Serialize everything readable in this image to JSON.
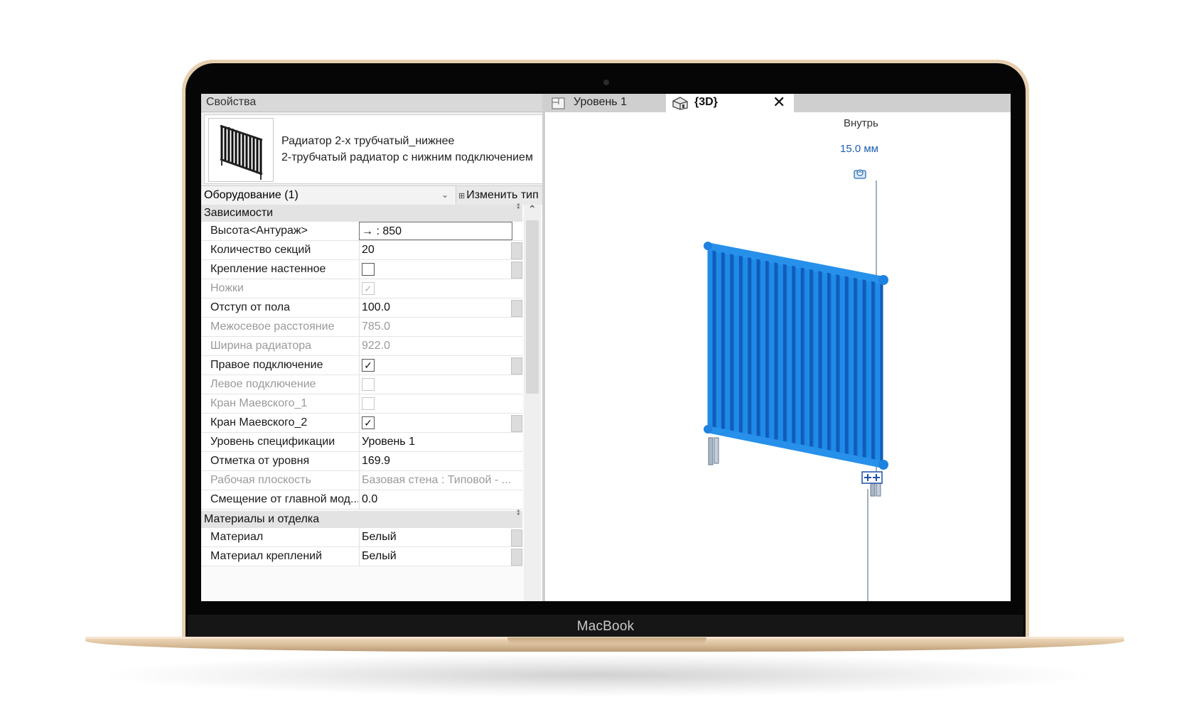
{
  "laptop": {
    "brand": "MacBook"
  },
  "properties": {
    "title": "Свойства",
    "type_name": "Радиатор 2-х трубчатый_нижнее",
    "type_description": "2-трубчатый радиатор с нижним подключением",
    "filter": "Оборудование (1)",
    "edit_type_label": "Изменить тип",
    "groups": [
      {
        "name": "Зависимости",
        "rows": [
          {
            "label": "Высота<Антураж>",
            "value": "→ : 850"
          },
          {
            "label": "Количество секций",
            "value": "20"
          },
          {
            "label": "Крепление настенное",
            "checked": false
          },
          {
            "label": "Ножки",
            "checked": true
          },
          {
            "label": "Отступ от пола",
            "value": "100.0"
          },
          {
            "label": "Межосевое расстояние",
            "value": "785.0"
          },
          {
            "label": "Ширина радиатора",
            "value": "922.0"
          },
          {
            "label": "Правое подключение",
            "checked": true
          },
          {
            "label": "Левое подключение",
            "checked": false
          },
          {
            "label": "Кран Маевского_1",
            "checked": false
          },
          {
            "label": "Кран Маевского_2",
            "checked": true
          },
          {
            "label": "Уровень спецификации",
            "value": "Уровень 1"
          },
          {
            "label": "Отметка от уровня",
            "value": "169.9"
          },
          {
            "label": "Рабочая плоскость",
            "value": "Базовая стена : Типовой - ..."
          },
          {
            "label": "Смещение от главной мод...",
            "value": "0.0"
          }
        ]
      },
      {
        "name": "Материалы и отделка",
        "rows": [
          {
            "label": "Материал",
            "value": "Белый"
          },
          {
            "label": "Материал креплений",
            "value": "Белый"
          }
        ]
      }
    ]
  },
  "tabs": [
    {
      "label": "Уровень 1",
      "icon": "floor-plan-icon"
    },
    {
      "label": "{3D}",
      "icon": "3d-house-icon"
    }
  ],
  "view": {
    "inside_label": "Внутрь",
    "offset_value": "15.0 мм",
    "model_color": "#1f8be8"
  }
}
